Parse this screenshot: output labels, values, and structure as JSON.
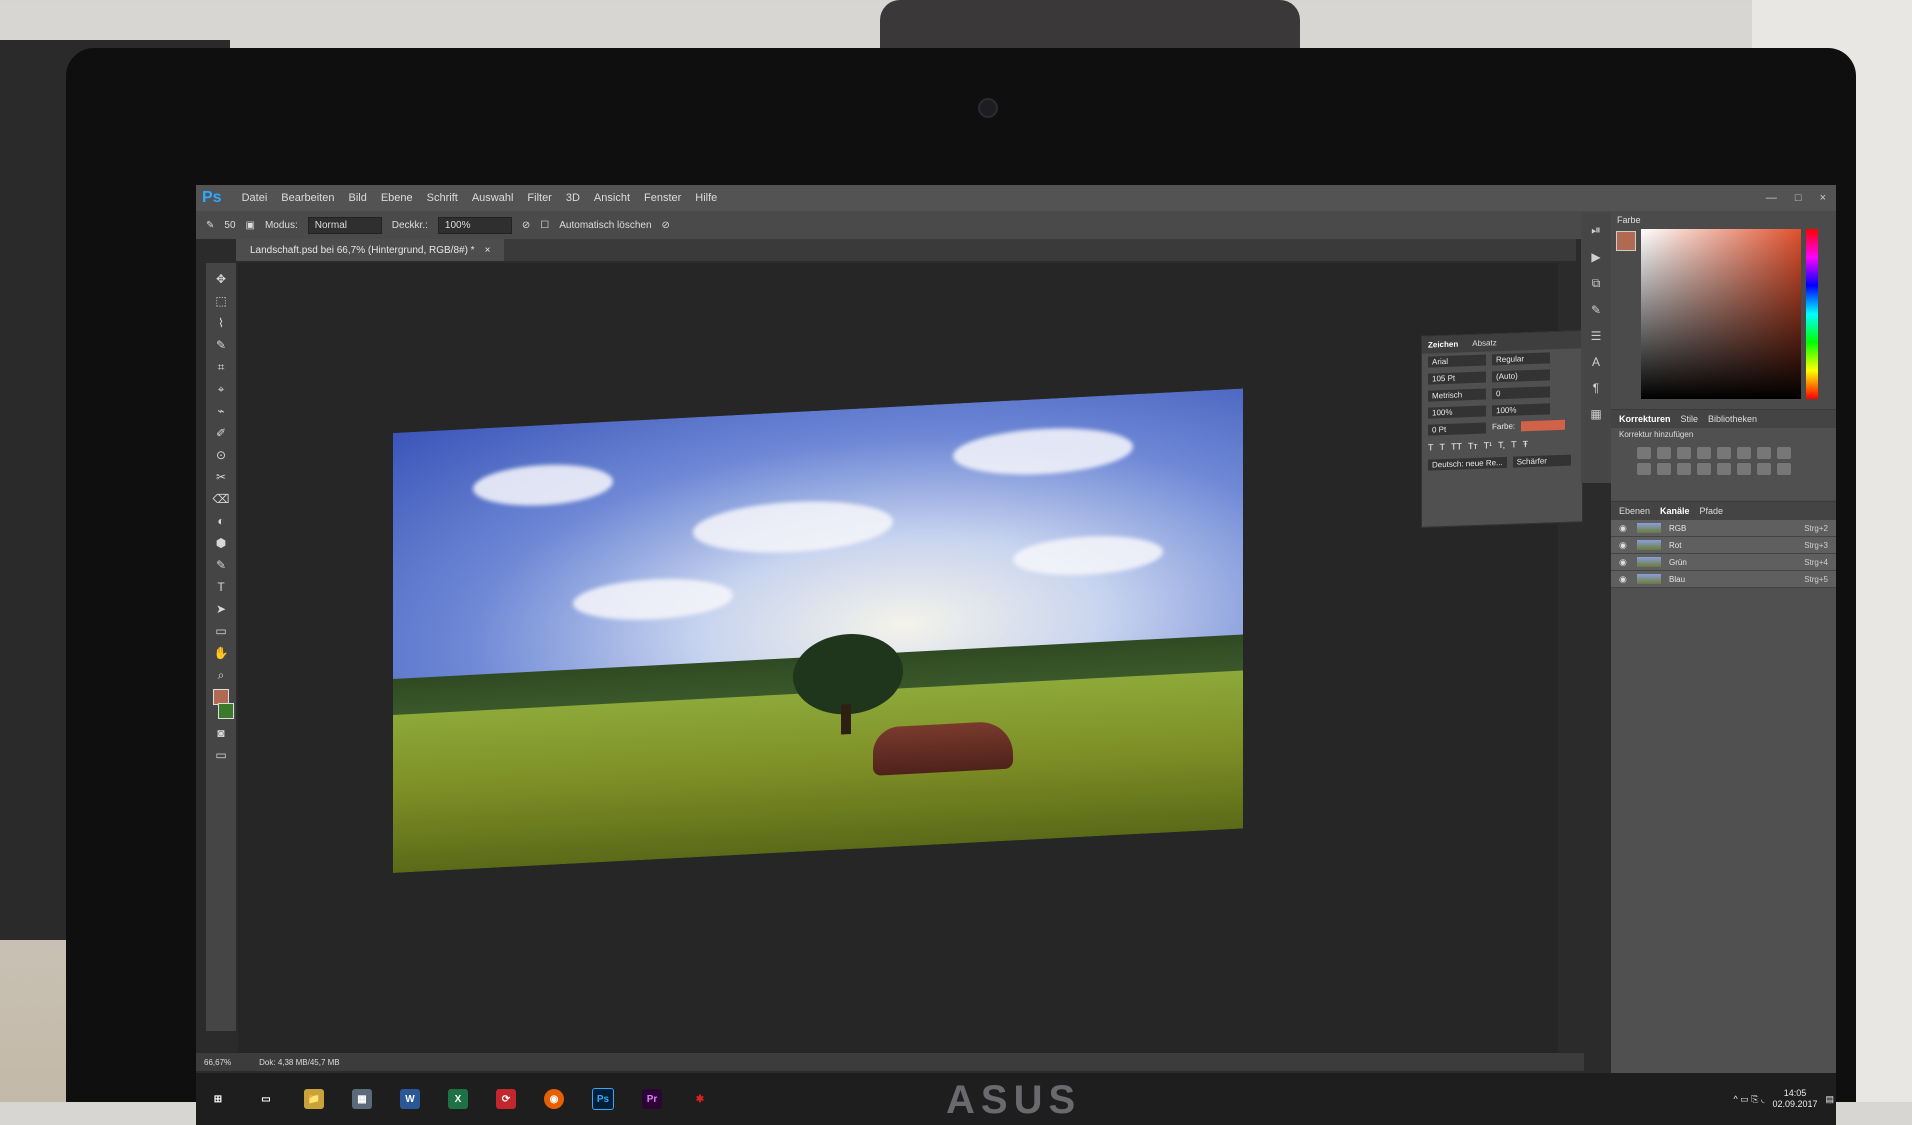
{
  "app": {
    "logo": "Ps",
    "menu": [
      "Datei",
      "Bearbeiten",
      "Bild",
      "Ebene",
      "Schrift",
      "Auswahl",
      "Filter",
      "3D",
      "Ansicht",
      "Fenster",
      "Hilfe"
    ],
    "window_controls": [
      "—",
      "□",
      "×"
    ]
  },
  "options": {
    "brush_size": "50",
    "modus_label": "Modus:",
    "modus_value": "Normal",
    "deckkr_label": "Deckkr.:",
    "deckkr_value": "100%",
    "auto_erase": "Automatisch löschen"
  },
  "document": {
    "tab_title": "Landschaft.psd bei 66,7% (Hintergrund, RGB/8#) *",
    "close": "×"
  },
  "tools": [
    "✥",
    "⬚",
    "⌇",
    "✎",
    "⌗",
    "⌖",
    "⌁",
    "✐",
    "⊙",
    "✂",
    "⌫",
    "◐",
    "⬢",
    "✎",
    "T",
    "➤",
    "▭",
    "✋",
    "⌕"
  ],
  "status": {
    "zoom": "66,67%",
    "doc": "Dok: 4,38 MB/45,7 MB"
  },
  "character_panel": {
    "tabs": [
      "Zeichen",
      "Absatz"
    ],
    "font": "Arial",
    "style": "Regular",
    "size": "105 Pt",
    "leading": "(Auto)",
    "kerning": "Metrisch",
    "tracking": "0",
    "vscale": "100%",
    "hscale": "100%",
    "baseline": "0 Pt",
    "color_label": "Farbe:",
    "language": "Deutsch: neue Re...",
    "aa": "Schärfer",
    "style_buttons": [
      "T",
      "T",
      "TT",
      "Tт",
      "T¹",
      "T,",
      "T",
      "Ŧ"
    ]
  },
  "right_panel": {
    "color_tab": "Farbe",
    "sections": {
      "corrections_tabs": [
        "Korrekturen",
        "Stile",
        "Bibliotheken"
      ],
      "corrections_label": "Korrektur hinzufügen",
      "layers_tabs": [
        "Ebenen",
        "Kanäle",
        "Pfade"
      ]
    },
    "channels": [
      {
        "name": "RGB",
        "shortcut": "Strg+2"
      },
      {
        "name": "Rot",
        "shortcut": "Strg+3"
      },
      {
        "name": "Grün",
        "shortcut": "Strg+4"
      },
      {
        "name": "Blau",
        "shortcut": "Strg+5"
      }
    ]
  },
  "taskbar": {
    "apps": [
      "⊞",
      "▭",
      "📁",
      "▦",
      "W",
      "X",
      "⟳",
      "◉",
      "Ps",
      "Pr",
      "✱"
    ],
    "tray": "^ ▭ ⎘ ◟ ",
    "time": "14:05",
    "date": "02.09.2017"
  },
  "hardware": {
    "brand": "ASUS"
  },
  "colors": {
    "accent": "#31a8ff",
    "foreground": "#b06a52",
    "background_swatch": "#3a7a2a"
  }
}
